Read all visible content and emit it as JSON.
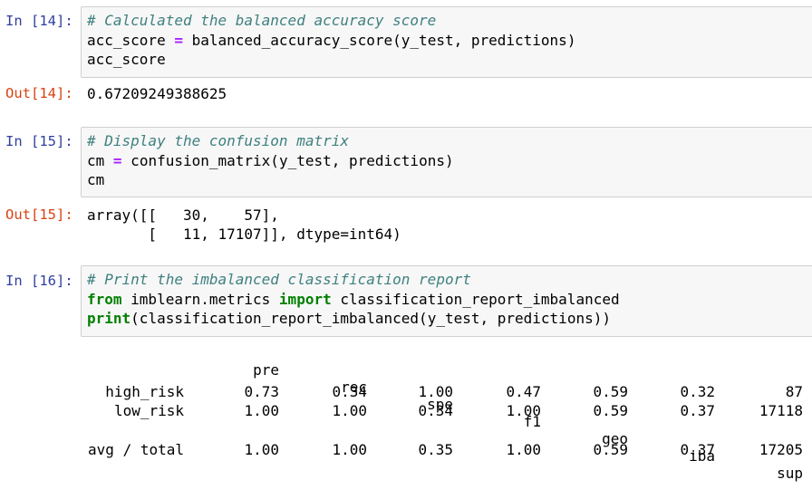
{
  "cells": [
    {
      "in_prompt": "In [14]:",
      "code": [
        [
          {
            "t": "cm",
            "v": "# Calculated the balanced accuracy score"
          }
        ],
        [
          {
            "t": "plain",
            "v": "acc_score "
          },
          {
            "t": "op",
            "v": "="
          },
          {
            "t": "plain",
            "v": " balanced_accuracy_score(y_test, predictions)"
          }
        ],
        [
          {
            "t": "plain",
            "v": "acc_score"
          }
        ]
      ],
      "out_prompt": "Out[14]:",
      "output": [
        "0.67209249388625"
      ]
    },
    {
      "in_prompt": "In [15]:",
      "code": [
        [
          {
            "t": "cm",
            "v": "# Display the confusion matrix"
          }
        ],
        [
          {
            "t": "plain",
            "v": "cm "
          },
          {
            "t": "op",
            "v": "="
          },
          {
            "t": "plain",
            "v": " confusion_matrix(y_test, predictions)"
          }
        ],
        [
          {
            "t": "plain",
            "v": "cm"
          }
        ]
      ],
      "out_prompt": "Out[15]:",
      "output": [
        "array([[   30,    57],",
        "       [   11, 17107]], dtype=int64)"
      ]
    },
    {
      "in_prompt": "In [16]:",
      "code": [
        [
          {
            "t": "cm",
            "v": "# Print the imbalanced classification report"
          }
        ],
        [
          {
            "t": "kw",
            "v": "from"
          },
          {
            "t": "plain",
            "v": " imblearn.metrics "
          },
          {
            "t": "kw",
            "v": "import"
          },
          {
            "t": "plain",
            "v": " classification_report_imbalanced"
          }
        ],
        [
          {
            "t": "kw",
            "v": "print"
          },
          {
            "t": "plain",
            "v": "(classification_report_imbalanced(y_test, predictions))"
          }
        ]
      ]
    }
  ],
  "report": {
    "headers": [
      "pre",
      "rec",
      "spe",
      "f1",
      "geo",
      "iba",
      "sup"
    ],
    "rows": [
      {
        "label": "high_risk",
        "values": [
          "0.73",
          "0.34",
          "1.00",
          "0.47",
          "0.59",
          "0.32",
          "87"
        ]
      },
      {
        "label": "low_risk",
        "values": [
          "1.00",
          "1.00",
          "0.34",
          "1.00",
          "0.59",
          "0.37",
          "17118"
        ]
      },
      {
        "label": "avg / total",
        "values": [
          "1.00",
          "1.00",
          "0.35",
          "1.00",
          "0.59",
          "0.37",
          "17205"
        ]
      }
    ]
  }
}
